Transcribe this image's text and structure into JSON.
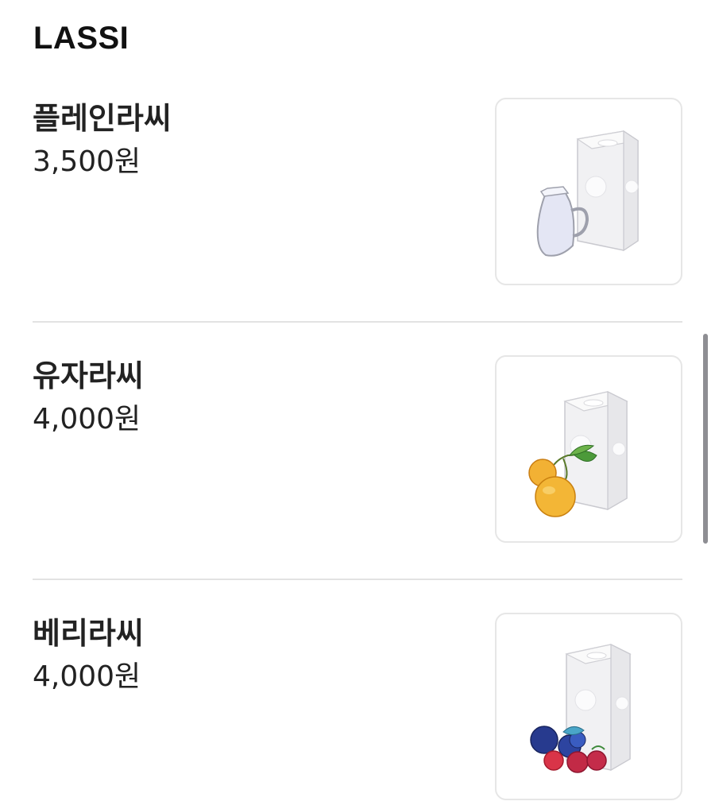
{
  "section": {
    "title": "LASSI"
  },
  "items": [
    {
      "name": "플레인라씨",
      "price": "3,500원",
      "image_icon": "plain-lassi-illustration"
    },
    {
      "name": "유자라씨",
      "price": "4,000원",
      "image_icon": "yuja-lassi-illustration"
    },
    {
      "name": "베리라씨",
      "price": "4,000원",
      "image_icon": "berry-lassi-illustration"
    }
  ],
  "colors": {
    "divider": "#e2e2e2",
    "thumb_border": "#e6e6e6",
    "scrollbar": "#8e8e93",
    "text": "#222222"
  }
}
